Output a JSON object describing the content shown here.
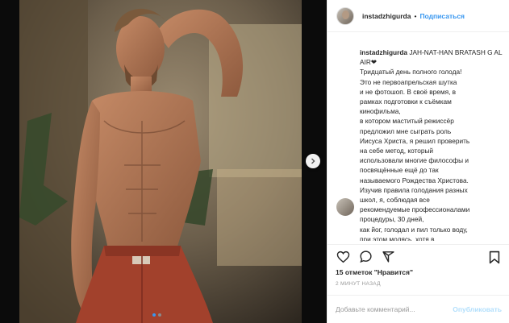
{
  "post": {
    "username": "instadzhigurda",
    "separator": "•",
    "follow_label": "Подписаться",
    "caption_title": "JAH-NAT-HAN BRATASH G AL AIR❤",
    "caption_lines": [
      "Тридцатый день полного голода!",
      "Это не первоапрельская шутка",
      "и не фотошоп. В своё время, в",
      "рамках подготовки к съёмкам",
      "кинофильма,",
      "в котором маститый режиссёр",
      "предложил мне сыграть роль",
      "Иисуса Христа, я решил проверить",
      "на себе метод, который",
      "использовали многие философы и",
      "посвящённые ещё до так",
      "называемого Рождества Христова.",
      "Изучив правила голодания разных",
      "школ, я, соблюдая все",
      "рекомендуемые профессионалами",
      "процедуры, 30 дней,",
      "как йог, голодал и пил только воду,",
      "при этом молясь, хотя в"
    ],
    "likes": "15 отметок \"Нравится\"",
    "time_ago": "2 МИНУТ НАЗАД",
    "comment_placeholder": "Добавьте комментарий...",
    "publish_label": "Опубликовать",
    "carousel_count": 2,
    "carousel_active": 1
  },
  "colors": {
    "accent": "#3897f0",
    "publish_disabled": "#b2dffc",
    "muted": "#999999"
  },
  "icons": {
    "like": "heart-icon",
    "comment": "comment-icon",
    "share": "share-icon",
    "save": "bookmark-icon",
    "next": "chevron-right-icon"
  }
}
